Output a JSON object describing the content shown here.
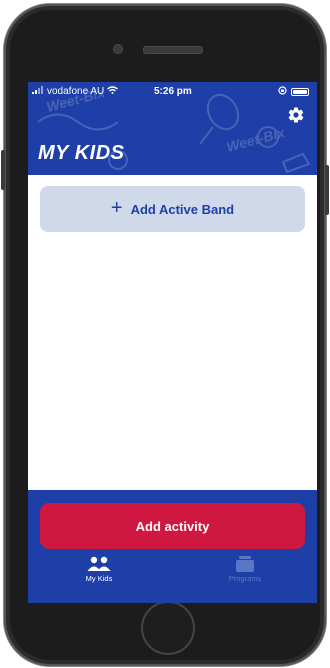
{
  "status_bar": {
    "carrier": "vodafone AU",
    "time": "5:26 pm"
  },
  "header": {
    "title": "MY KIDS",
    "settings_icon": "gear-icon",
    "decoration_text": "Weet-Bix"
  },
  "main": {
    "add_band_label": "Add Active Band",
    "add_band_icon": "plus-icon"
  },
  "bottom": {
    "add_activity_label": "Add activity"
  },
  "tabs": [
    {
      "label": "My Kids",
      "icon": "people-icon",
      "active": true
    },
    {
      "label": "Programs",
      "icon": "programs-icon",
      "active": false
    }
  ],
  "colors": {
    "brand_blue": "#1f3fa8",
    "accent_red": "#cf1840",
    "band_button_bg": "#cfd9ea",
    "inactive_tab": "#5a76c6"
  }
}
